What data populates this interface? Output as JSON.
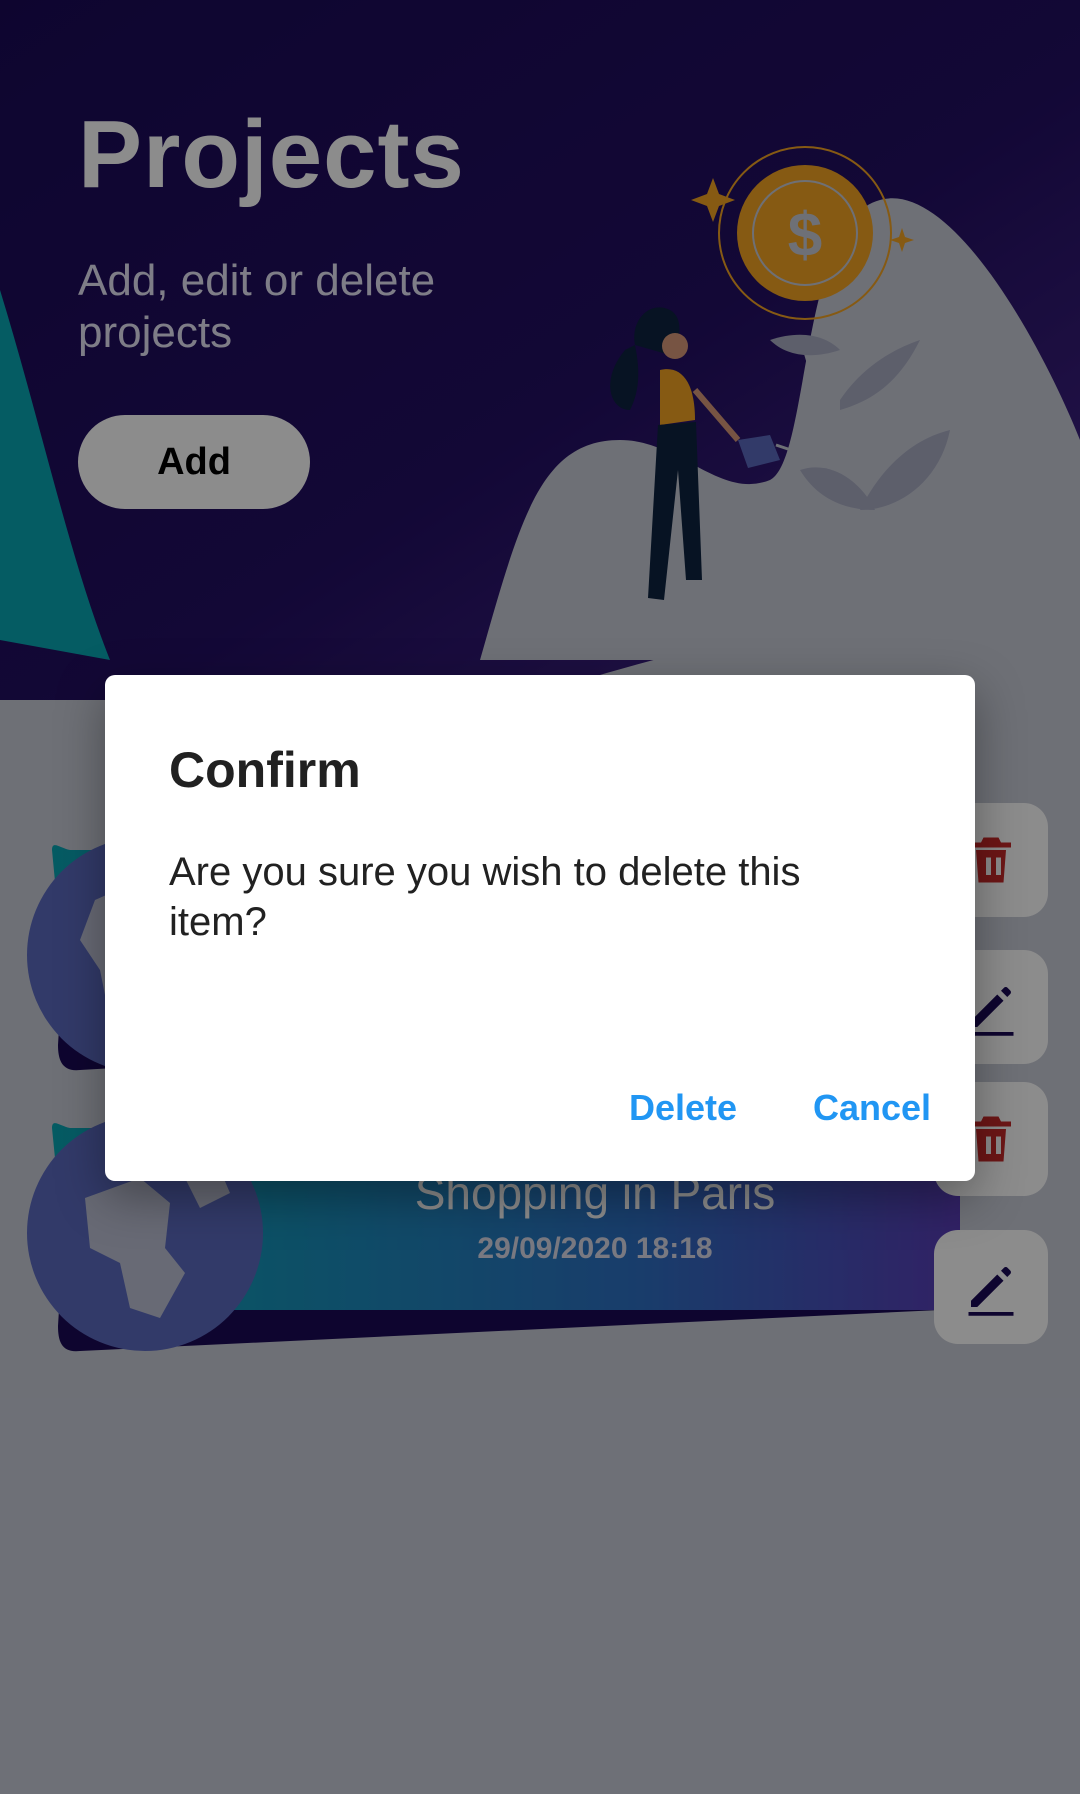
{
  "header": {
    "title": "Projects",
    "subtitle": "Add, edit or delete projects",
    "add_label": "Add"
  },
  "projects": [
    {
      "title": "",
      "date": ""
    },
    {
      "title": "Shopping in Paris",
      "date": "29/09/2020 18:18"
    }
  ],
  "dialog": {
    "title": "Confirm",
    "message": "Are you sure you wish to delete this item?",
    "delete_label": "Delete",
    "cancel_label": "Cancel"
  },
  "colors": {
    "header_dark": "#1b0a57",
    "header_purple": "#4a2a8f",
    "teal": "#0aa8b5",
    "accent_orange": "#f4a423",
    "button_blue": "#2196f3",
    "delete_red": "#c62828"
  },
  "icons": [
    "dollar-coin-icon",
    "globe-icon",
    "trash-icon",
    "edit-icon"
  ]
}
